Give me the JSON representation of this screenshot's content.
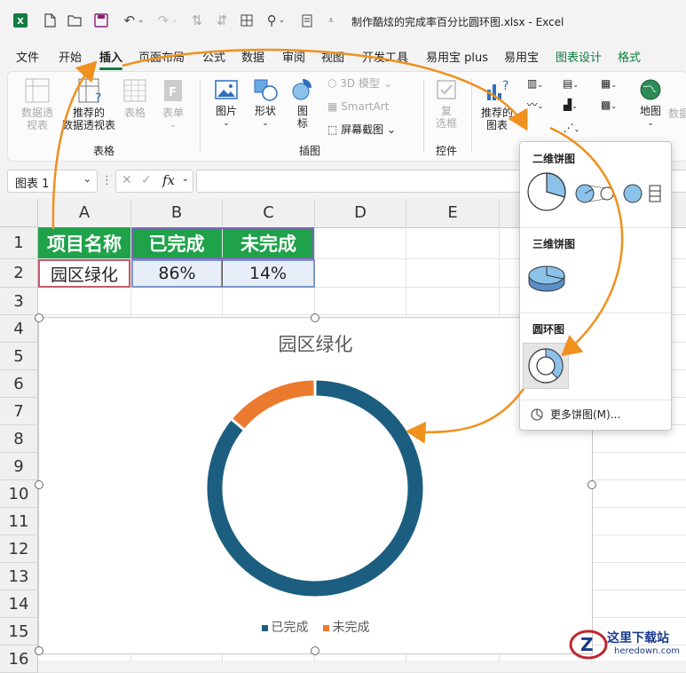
{
  "titlebar": {
    "file_title": "制作酷炫的完成率百分比圆环图.xlsx  -  Excel"
  },
  "tabs": [
    "文件",
    "开始",
    "插入",
    "页面布局",
    "公式",
    "数据",
    "审阅",
    "视图",
    "开发工具",
    "易用宝 plus",
    "易用宝",
    "图表设计",
    "格式"
  ],
  "ribbon": {
    "pivot_table": "数据透\n视表",
    "recommended_pivot": "推荐的\n数据透视表",
    "table": "表格",
    "form": "表单",
    "picture": "图片",
    "shapes": "形状",
    "icons": "图\n标",
    "model3d": "3D 模型",
    "smartart": "SmartArt",
    "screenshot": "屏幕截图",
    "checkbox": "复\n选框",
    "recommended_charts": "推荐的\n图表",
    "map": "地图",
    "pivotchart": "数据",
    "group_tables": "表格",
    "group_illustrations": "插图",
    "group_controls": "控件"
  },
  "formula_bar": {
    "name_box": "图表 1",
    "fx": "fx",
    "value": ""
  },
  "columns": [
    "A",
    "B",
    "C",
    "D",
    "E"
  ],
  "rows": [
    "1",
    "2",
    "3",
    "4",
    "5",
    "6",
    "7",
    "8",
    "9",
    "10",
    "11",
    "12",
    "13",
    "14",
    "15",
    "16"
  ],
  "table": {
    "headers": [
      "项目名称",
      "已完成",
      "未完成"
    ],
    "row": [
      "园区绿化",
      "86%",
      "14%"
    ]
  },
  "chart_data": {
    "type": "pie",
    "subtype": "doughnut",
    "title": "园区绿化",
    "categories": [
      "已完成",
      "未完成"
    ],
    "values": [
      86,
      14
    ],
    "colors": [
      "#1b5e80",
      "#ec7a2e"
    ],
    "legend": "bottom"
  },
  "pie_menu": {
    "section_2d": "二维饼图",
    "section_3d": "三维饼图",
    "section_donut": "圆环图",
    "more": "更多饼图(M)..."
  },
  "watermark": {
    "text_cn": "这里下载站",
    "text_en": "heredown.com"
  },
  "colors": {
    "excel_green": "#107c41",
    "header_green": "#1fa24a",
    "arrow_orange": "#f0901e"
  }
}
